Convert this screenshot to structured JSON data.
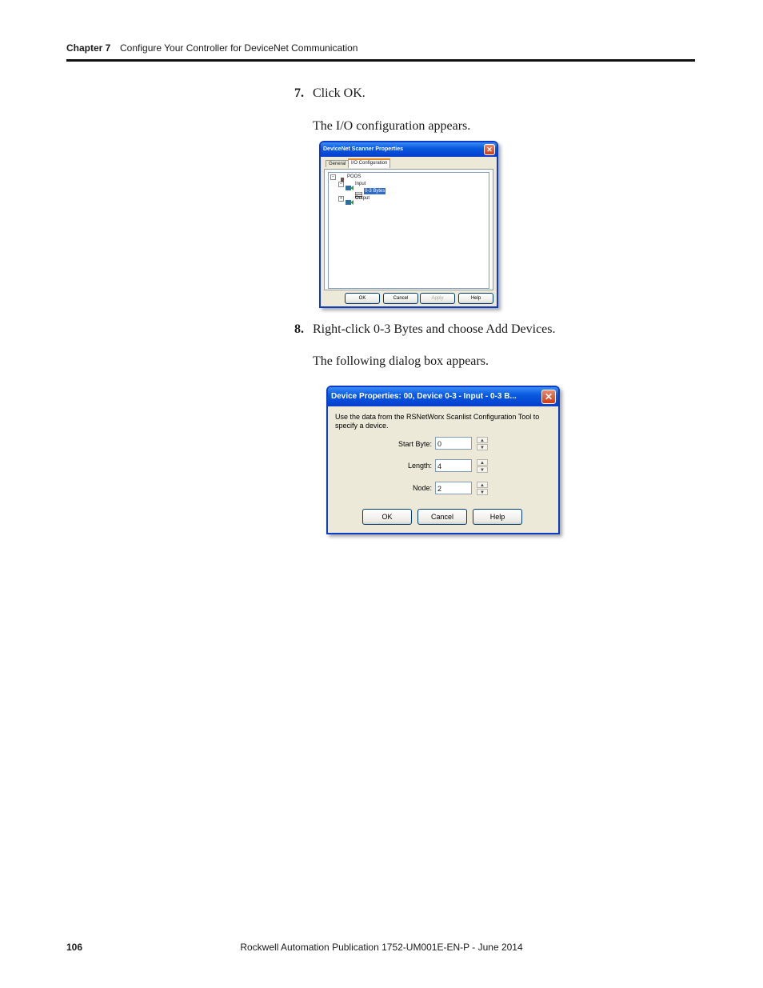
{
  "header": {
    "chapter": "Chapter 7",
    "title": "Configure Your Controller for DeviceNet Communication"
  },
  "steps": [
    {
      "number": "7.",
      "text": "Click OK.",
      "result": "The I/O configuration appears."
    },
    {
      "number": "8.",
      "text": "Right-click 0-3 Bytes and choose Add Devices.",
      "result": "The following dialog box appears."
    }
  ],
  "scanner_dialog": {
    "title": "DeviceNet Scanner Properties",
    "close": "✕",
    "tabs": [
      "General",
      "I/O Configuration"
    ],
    "tree": {
      "root": "POOS",
      "input": "Input",
      "input_child": "0-3 Bytes",
      "output": "Output"
    },
    "buttons": {
      "ok": "OK",
      "cancel": "Cancel",
      "apply": "Apply",
      "help": "Help"
    }
  },
  "device_dialog": {
    "title": "Device Properties: 00, Device 0-3 - Input - 0-3 B...",
    "close": "✕",
    "instructions": "Use the data from the RSNetWorx Scanlist Configuration Tool to specify a device.",
    "fields": {
      "start_byte": {
        "label": "Start Byte:",
        "value": "0"
      },
      "length": {
        "label": "Length:",
        "value": "4"
      },
      "node": {
        "label": "Node:",
        "value": "2"
      }
    },
    "buttons": {
      "ok": "OK",
      "cancel": "Cancel",
      "help": "Help"
    }
  },
  "footer": {
    "page": "106",
    "publication": "Rockwell Automation Publication 1752-UM001E-EN-P - June 2014"
  }
}
